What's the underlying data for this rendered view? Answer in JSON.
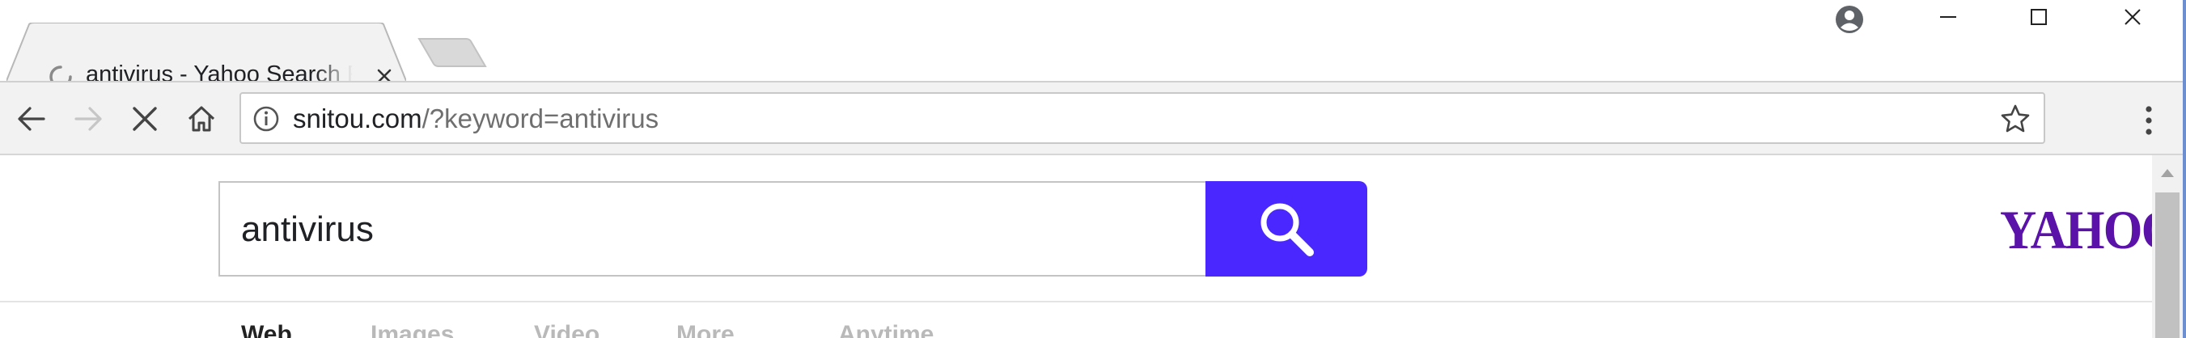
{
  "browser": {
    "tab": {
      "title": "antivirus - Yahoo Search Results",
      "close_icon": "close-icon",
      "loading_icon": "spinner-icon"
    },
    "new_tab_icon": "new-tab-icon",
    "window_controls": [
      "profile-icon",
      "minimize-icon",
      "maximize-icon",
      "close-icon"
    ],
    "toolbar": {
      "back_icon": "arrow-left-icon",
      "forward_icon": "arrow-right-icon",
      "stop_icon": "stop-loading-icon",
      "home_icon": "home-icon",
      "menu_icon": "more-vertical-icon"
    },
    "omnibox": {
      "host": "snitou.com",
      "path": "/?keyword=antivirus",
      "info_icon": "info-icon",
      "bookmark_icon": "star-icon"
    }
  },
  "page": {
    "search": {
      "query": "antivirus",
      "button_icon": "search-icon",
      "button_color": "#4a27ff"
    },
    "logo": {
      "text": "YAHOO!",
      "color": "#5a12a8"
    },
    "vertical_tabs": [
      {
        "label": "Web",
        "active": true
      },
      {
        "label": "Images",
        "active": false
      },
      {
        "label": "Video",
        "active": false
      },
      {
        "label": "More",
        "active": false
      },
      {
        "label": "Anytime",
        "active": false
      }
    ]
  },
  "colors": {
    "toolbar_bg": "#f2f2f2",
    "accent": "#4a27ff",
    "yahoo_purple": "#5a12a8"
  }
}
